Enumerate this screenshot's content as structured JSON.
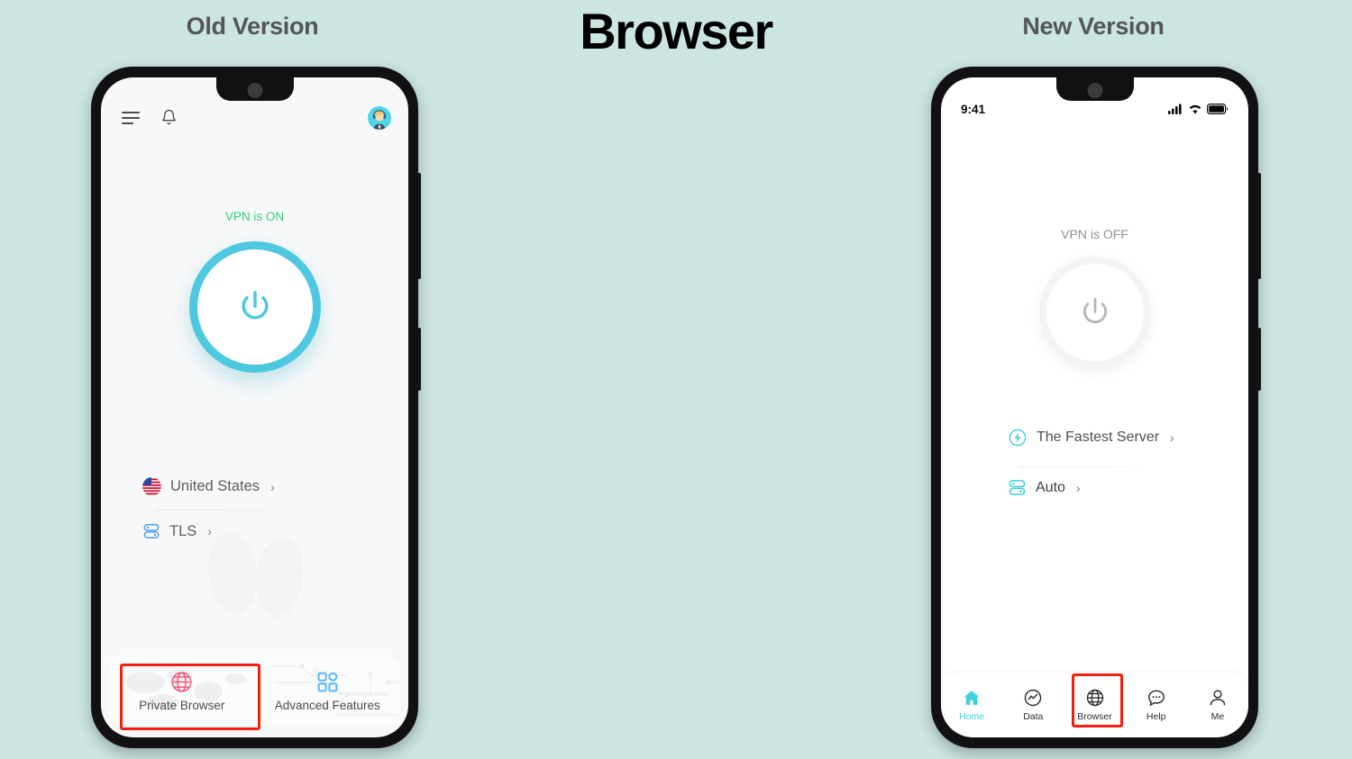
{
  "page": {
    "background_color": "#cbe5e3",
    "main_title": "Browser"
  },
  "colors": {
    "accent_cyan": "#3fd0dd",
    "ring_cyan": "#4ec8e0",
    "vpn_on_green": "#35d07f",
    "vpn_off_gray": "#8e9093",
    "highlight_red": "#f71d0c",
    "globe_pink": "#f2547d",
    "grid_blue": "#5bb8f5"
  },
  "old": {
    "title": "Old Version",
    "topbar": {
      "menu_icon": "hamburger-icon",
      "bell_icon": "bell-icon",
      "avatar_icon": "support-agent-avatar"
    },
    "vpn_status": "VPN is ON",
    "power_button": {
      "icon": "power-icon",
      "state": "on"
    },
    "rows": [
      {
        "icon": "us-flag-icon",
        "label": "United States",
        "chevron": "›"
      },
      {
        "icon": "protocol-icon",
        "label": "TLS",
        "chevron": "›"
      }
    ],
    "bottom_cards": [
      {
        "icon": "globe-icon",
        "label": "Private Browser",
        "highlighted": true
      },
      {
        "icon": "grid-apps-icon",
        "label": "Advanced Features",
        "highlighted": false
      }
    ]
  },
  "new": {
    "title": "New Version",
    "statusbar": {
      "time": "9:41",
      "icons": [
        "signal-icon",
        "wifi-icon",
        "battery-icon"
      ]
    },
    "vpn_status": "VPN is OFF",
    "power_button": {
      "icon": "power-icon",
      "state": "off"
    },
    "rows": [
      {
        "icon": "lightning-bolt-icon",
        "label": "The Fastest Server",
        "chevron": "›"
      },
      {
        "icon": "protocol-icon",
        "label": "Auto",
        "chevron": "›"
      }
    ],
    "tabbar": [
      {
        "icon": "home-icon",
        "label": "Home",
        "active": true,
        "highlighted": false
      },
      {
        "icon": "data-icon",
        "label": "Data",
        "active": false,
        "highlighted": false
      },
      {
        "icon": "globe-icon",
        "label": "Browser",
        "active": false,
        "highlighted": true
      },
      {
        "icon": "chat-icon",
        "label": "Help",
        "active": false,
        "highlighted": false
      },
      {
        "icon": "person-icon",
        "label": "Me",
        "active": false,
        "highlighted": false
      }
    ]
  }
}
